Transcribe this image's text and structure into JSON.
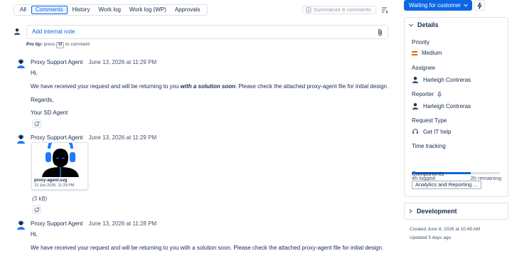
{
  "tabs": [
    {
      "label": "All",
      "active": false
    },
    {
      "label": "Comments",
      "active": true
    },
    {
      "label": "History",
      "active": false
    },
    {
      "label": "Work log",
      "active": false
    },
    {
      "label": "Work log (WP)",
      "active": false
    },
    {
      "label": "Approvals",
      "active": false
    }
  ],
  "toolbar": {
    "summarize_label": "Summarize 8 comments",
    "summarize_icon": "sparkle-icon",
    "sort_icon": "sort-icon"
  },
  "note": {
    "placeholder": "Add internal note",
    "protip_prefix": "Pro tip:",
    "protip_press": "press",
    "protip_key": "M",
    "protip_suffix": "to comment"
  },
  "comments": [
    {
      "author": "Proxy Support Agent",
      "time": "June 13, 2026 at 11:29 PM",
      "lines": {
        "greet": "Hi,",
        "body_before": "We have received your request and will be returning to you ",
        "body_emph": "with a solution soon",
        "body_after": ".  Please check the attached proxy-agent file for initial design.",
        "regards": "Regards,",
        "sign": "Your SD Agent"
      }
    },
    {
      "author": "Proxy Support Agent",
      "time": "June 13, 2026 at 11:29 PM",
      "attachment": {
        "filename": "proxy-agent.svg",
        "date": "13 Jun 2026, 11:29 PM",
        "size": "(3 kB)"
      }
    },
    {
      "author": "Proxy Support Agent",
      "time": "June 13, 2026 at 11:28 PM",
      "lines": {
        "greet": "Hi,",
        "body": "We have received your request and will be returning to you with a solution soon.  Please check the attached proxy-agent file for initial design."
      }
    }
  ],
  "status": {
    "label": "Waiting for customer",
    "color": "#0c66e4"
  },
  "details": {
    "title": "Details",
    "priority_label": "Priority",
    "priority_value": "Medium",
    "priority_color": "#e56910",
    "assignee_label": "Assignee",
    "assignee_value": "Harleigh Contreras",
    "reporter_label": "Reporter",
    "reporter_value": "Harleigh Contreras",
    "request_type_label": "Request Type",
    "request_type_value": "Get IT help",
    "time_tracking_label": "Time tracking",
    "time_logged": "4h logged",
    "time_remaining": "2h remaining",
    "time_progress": 0.67,
    "components_label": "Components",
    "components_value": "Analytics and Reporting ..."
  },
  "development": {
    "title": "Development"
  },
  "footer": {
    "created": "Created June 8, 2026 at 10:49 AM",
    "updated": "Updated 5 days ago"
  }
}
